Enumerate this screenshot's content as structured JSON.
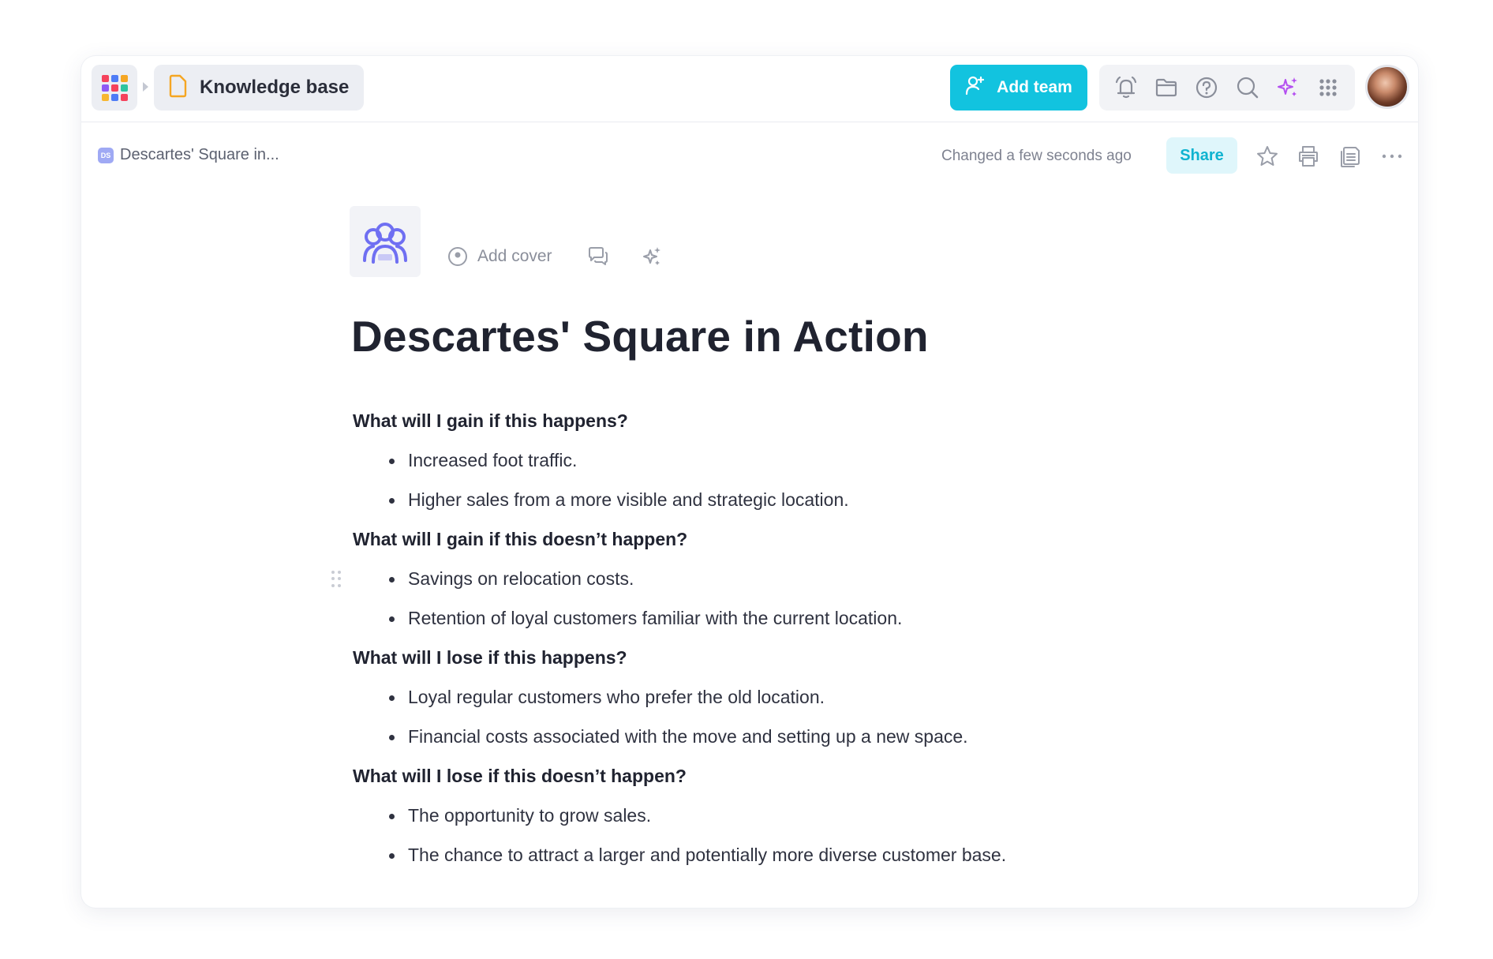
{
  "topbar": {
    "workspace_label": "Knowledge base",
    "add_team_label": "Add team",
    "apps_colors": [
      "#f5425c",
      "#4e7cf6",
      "#f5a623",
      "#8e59f4",
      "#f5425c",
      "#2ec4a0",
      "#f7b731",
      "#4e7cf6",
      "#f5425c"
    ],
    "toolbar_icons": [
      "bell-icon",
      "folder-icon",
      "help-icon",
      "search-icon",
      "ai-sparkle-icon",
      "apps-grid-icon"
    ]
  },
  "subbar": {
    "badge": "DS",
    "doc_crumb": "Descartes' Square in...",
    "status": "Changed a few seconds ago",
    "share_label": "Share"
  },
  "doc": {
    "add_cover_label": "Add cover",
    "title": "Descartes' Square in Action",
    "sections": [
      {
        "heading": "What will I gain if this happens?",
        "items": [
          "Increased foot traffic.",
          "Higher sales from a more visible and strategic location."
        ]
      },
      {
        "heading": "What will I gain if this doesn’t happen?",
        "items": [
          "Savings on relocation costs.",
          "Retention of loyal customers familiar with the current location."
        ]
      },
      {
        "heading": "What will I lose if this happens?",
        "items": [
          "Loyal regular customers who prefer the old location.",
          "Financial costs associated with the move and setting up a new space."
        ]
      },
      {
        "heading": "What will I lose if this doesn’t happen?",
        "items": [
          "The opportunity to grow sales.",
          "The chance to attract a larger and potentially more diverse customer base."
        ]
      }
    ]
  },
  "colors": {
    "accent": "#12c3df",
    "ai": "#b44ff0",
    "doc_icon": "#6f6ff2"
  }
}
